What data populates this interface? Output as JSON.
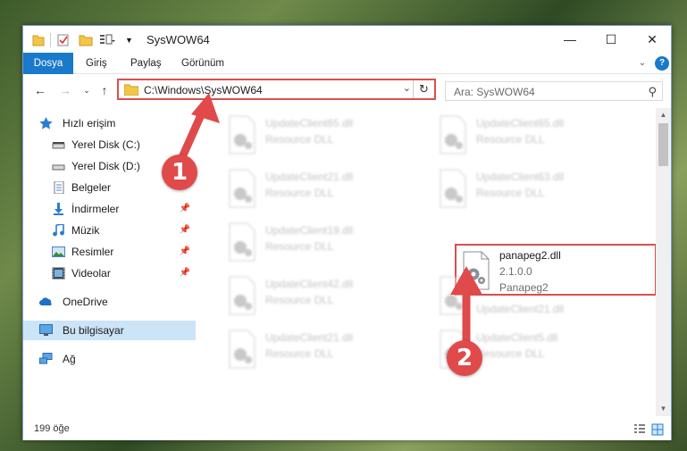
{
  "window": {
    "title": "SysWOW64"
  },
  "ribbon": {
    "tabs": [
      "Dosya",
      "Giriş",
      "Paylaş",
      "Görünüm"
    ]
  },
  "address": {
    "path": "C:\\Windows\\SysWOW64"
  },
  "search": {
    "placeholder": "Ara: SysWOW64"
  },
  "sidebar": {
    "items": [
      {
        "label": "Hızlı erişim",
        "icon": "star-icon"
      },
      {
        "label": "Yerel Disk (C:)",
        "icon": "drive-icon"
      },
      {
        "label": "Yerel Disk (D:)",
        "icon": "drive-icon"
      },
      {
        "label": "Belgeler",
        "icon": "documents-icon"
      },
      {
        "label": "İndirmeler",
        "icon": "download-icon"
      },
      {
        "label": "Müzik",
        "icon": "music-icon"
      },
      {
        "label": "Resimler",
        "icon": "pictures-icon"
      },
      {
        "label": "Videolar",
        "icon": "video-icon"
      },
      {
        "label": "OneDrive",
        "icon": "cloud-icon"
      },
      {
        "label": "Bu bilgisayar",
        "icon": "computer-icon"
      },
      {
        "label": "Ağ",
        "icon": "network-icon"
      }
    ]
  },
  "files": [
    {
      "name": "UpdateClient65.dll",
      "type": "Resource DLL"
    },
    {
      "name": "UpdateClient65.dll",
      "type": "Resource DLL"
    },
    {
      "name": "UpdateClient21.dll",
      "type": "Resource DLL"
    },
    {
      "name": "UpdateClient63.dll",
      "type": "Resource DLL"
    },
    {
      "name": "UpdateClient19.dll",
      "type": "Resource DLL"
    },
    {
      "name": "UpdateClient42.dll",
      "type": "Resource DLL"
    },
    {
      "name": "UpdateClient21.dll",
      "type": "Resource DLL"
    },
    {
      "name": "UpdateClient21.dll",
      "type": "Resource DLL"
    },
    {
      "name": "UpdateClient5.dll",
      "type": "Resource DLL"
    }
  ],
  "highlighted_file": {
    "name": "panapeg2.dll",
    "version": "2.1.0.0",
    "description": "Panapeg2"
  },
  "status": {
    "item_count": "199 öğe"
  },
  "annotations": {
    "step1": "1",
    "step2": "2"
  },
  "colors": {
    "accent": "#1979ca",
    "annotation": "#e04a4a",
    "selection": "#cce4f7"
  }
}
